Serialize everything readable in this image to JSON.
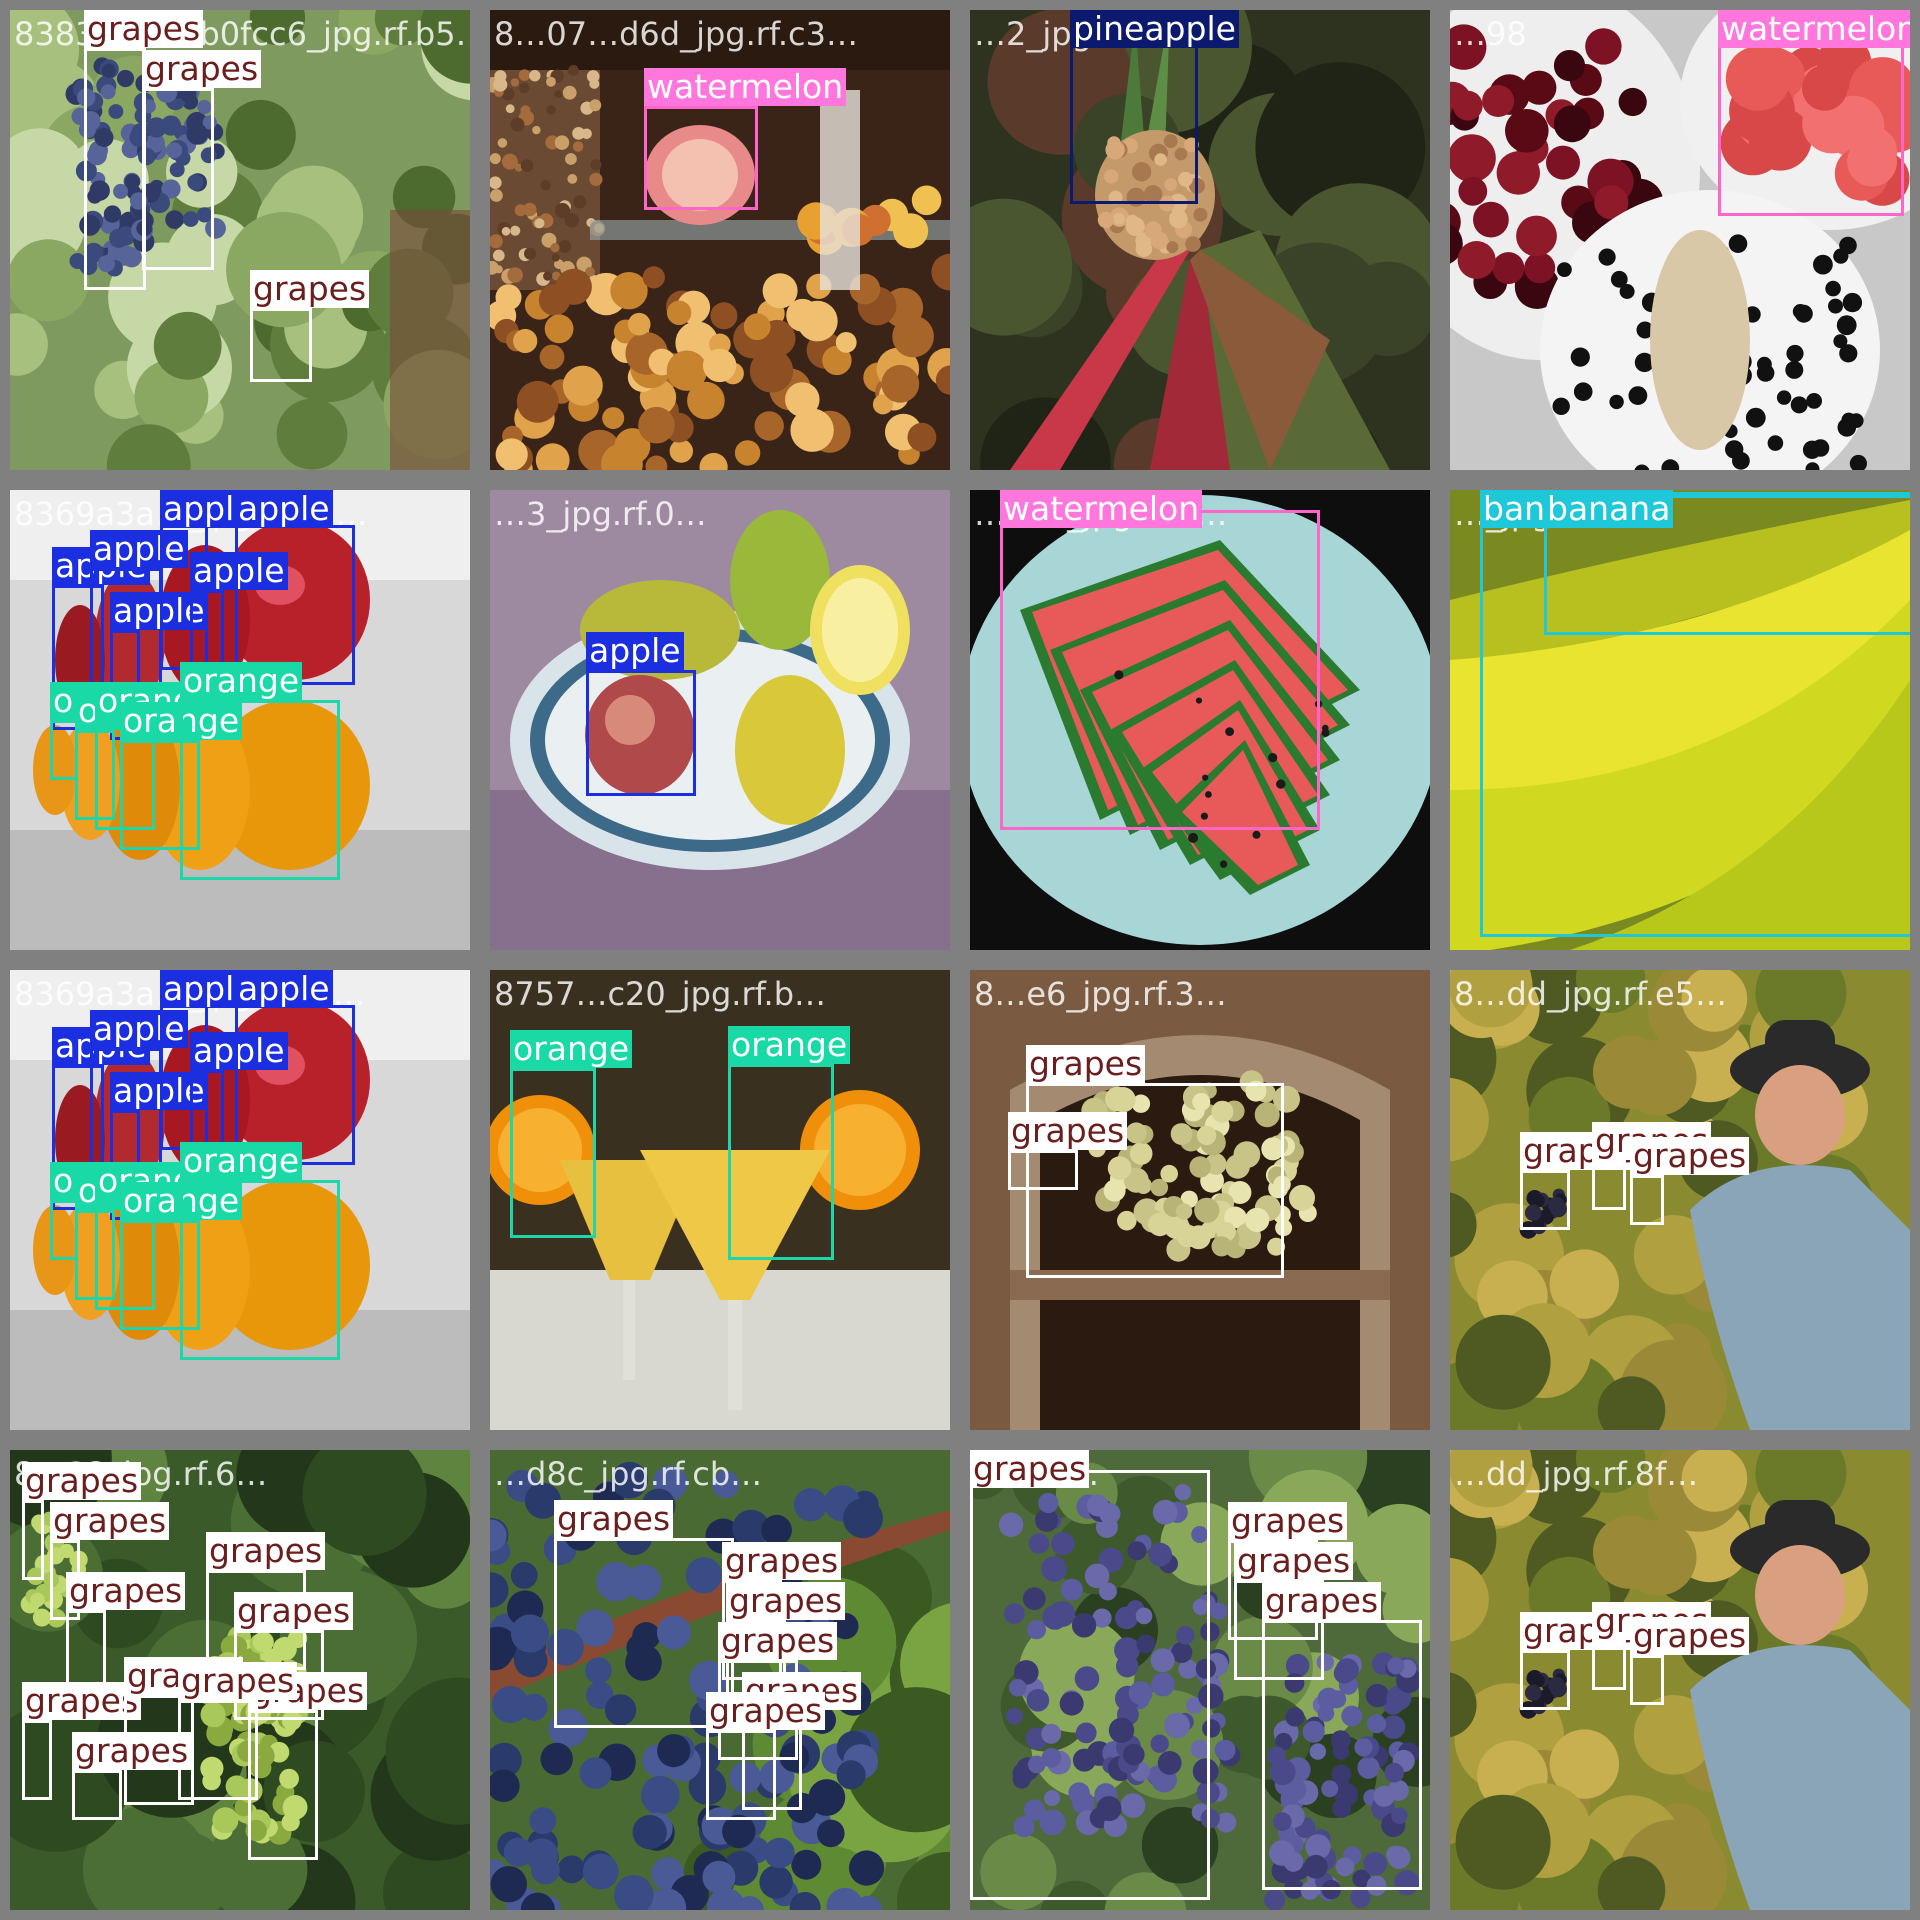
{
  "palette": {
    "grapes": {
      "box": "#ffffff",
      "label_bg": "#ffffff",
      "label_fg": "#6b1e1e"
    },
    "watermelon": {
      "box": "#ff66cc",
      "label_bg": "#ff77dd",
      "label_fg": "#ffffff"
    },
    "pineapple": {
      "box": "#0b1a6e",
      "label_bg": "#0b1a6e",
      "label_fg": "#ffffff"
    },
    "apple": {
      "box": "#1b2ee0",
      "label_bg": "#1b2ee0",
      "label_fg": "#ffffff"
    },
    "orange": {
      "box": "#1ed6a8",
      "label_bg": "#19d9a6",
      "label_fg": "#ffffff"
    },
    "banana": {
      "box": "#1ec8d8",
      "label_bg": "#1ec8d8",
      "label_fg": "#ffffff"
    }
  },
  "tiles": [
    {
      "filename": "8383e…1…b0fcc6_jpg.rf.b5…",
      "scene": "vine-leaves",
      "detections": [
        {
          "cls": "grapes",
          "label": "grapes"
        },
        {
          "cls": "grapes",
          "label": "grapes"
        },
        {
          "cls": "grapes",
          "label": "grapes"
        }
      ]
    },
    {
      "filename": "8…07…d6d_jpg.rf.c3…",
      "scene": "buffet",
      "detections": [
        {
          "cls": "watermelon",
          "label": "watermelon"
        }
      ]
    },
    {
      "filename": "…2_jpg.rf.c6…",
      "scene": "pineapple-plant",
      "detections": [
        {
          "cls": "pineapple",
          "label": "pineapple"
        }
      ]
    },
    {
      "filename": "…98",
      "scene": "cherries-bowls",
      "detections": [
        {
          "cls": "watermelon",
          "label": "watermelon"
        }
      ]
    },
    {
      "filename": "8369a3a…_jpg.rf.db…",
      "scene": "apples-oranges",
      "detections": [
        {
          "cls": "apple",
          "label": "apple"
        },
        {
          "cls": "apple",
          "label": "apple"
        },
        {
          "cls": "apple",
          "label": "apple"
        },
        {
          "cls": "apple",
          "label": "apple"
        },
        {
          "cls": "apple",
          "label": "apple"
        },
        {
          "cls": "apple",
          "label": "apple"
        },
        {
          "cls": "orange",
          "label": "orange"
        },
        {
          "cls": "orange",
          "label": "orange"
        },
        {
          "cls": "orange",
          "label": "orange"
        },
        {
          "cls": "orange",
          "label": "orange"
        },
        {
          "cls": "orange",
          "label": "orange"
        }
      ]
    },
    {
      "filename": "…3_jpg.rf.0…",
      "scene": "lemon-painting",
      "detections": [
        {
          "cls": "apple",
          "label": "apple"
        }
      ]
    },
    {
      "filename": "…526_jpg.rf.4…",
      "scene": "watermelon-plate",
      "detections": [
        {
          "cls": "watermelon",
          "label": "watermelon"
        }
      ]
    },
    {
      "filename": "…_jpg.rf.552",
      "scene": "bananas",
      "detections": [
        {
          "cls": "banana",
          "label": "banana"
        },
        {
          "cls": "banana",
          "label": "banana"
        }
      ]
    },
    {
      "filename": "8369a3a…_jpg.rf.5c…",
      "scene": "apples-oranges",
      "detections": [
        {
          "cls": "apple",
          "label": "apple"
        },
        {
          "cls": "apple",
          "label": "apple"
        },
        {
          "cls": "apple",
          "label": "apple"
        },
        {
          "cls": "apple",
          "label": "apple"
        },
        {
          "cls": "apple",
          "label": "apple"
        },
        {
          "cls": "apple",
          "label": "apple"
        },
        {
          "cls": "orange",
          "label": "orange"
        },
        {
          "cls": "orange",
          "label": "orange"
        },
        {
          "cls": "orange",
          "label": "orange"
        },
        {
          "cls": "orange",
          "label": "orange"
        },
        {
          "cls": "orange",
          "label": "orange"
        }
      ]
    },
    {
      "filename": "8757…c20_jpg.rf.b…",
      "scene": "orange-cocktails",
      "detections": [
        {
          "cls": "orange",
          "label": "orange"
        },
        {
          "cls": "orange",
          "label": "orange"
        }
      ]
    },
    {
      "filename": "8…e6_jpg.rf.3…",
      "scene": "grapes-painting",
      "detections": [
        {
          "cls": "grapes",
          "label": "grapes"
        },
        {
          "cls": "grapes",
          "label": "grapes"
        }
      ]
    },
    {
      "filename": "8…dd_jpg.rf.e5…",
      "scene": "harvester",
      "detections": [
        {
          "cls": "grapes",
          "label": "grapes"
        },
        {
          "cls": "grapes",
          "label": "grapes"
        },
        {
          "cls": "grapes",
          "label": "grapes"
        }
      ]
    },
    {
      "filename": "8…32_jpg.rf.6…",
      "scene": "green-grapes",
      "detections": [
        {
          "cls": "grapes",
          "label": "grapes"
        },
        {
          "cls": "grapes",
          "label": "grapes"
        },
        {
          "cls": "grapes",
          "label": "grapes"
        },
        {
          "cls": "grapes",
          "label": "grapes"
        },
        {
          "cls": "grapes",
          "label": "grapes"
        },
        {
          "cls": "grapes",
          "label": "grapes"
        },
        {
          "cls": "grapes",
          "label": "grapes"
        },
        {
          "cls": "grapes",
          "label": "grapes"
        },
        {
          "cls": "grapes",
          "label": "grapes"
        },
        {
          "cls": "grapes",
          "label": "grapes"
        }
      ]
    },
    {
      "filename": "…d8c_jpg.rf.cb…",
      "scene": "blue-grapes",
      "detections": [
        {
          "cls": "grapes",
          "label": "grapes"
        },
        {
          "cls": "grapes",
          "label": "grapes"
        },
        {
          "cls": "grapes",
          "label": "grapes"
        },
        {
          "cls": "grapes",
          "label": "grapes"
        },
        {
          "cls": "grapes",
          "label": "grapes"
        },
        {
          "cls": "grapes",
          "label": "grapes"
        }
      ]
    },
    {
      "filename": "…759…",
      "scene": "purple-grapes",
      "detections": [
        {
          "cls": "grapes",
          "label": "grapes"
        },
        {
          "cls": "grapes",
          "label": "grapes"
        },
        {
          "cls": "grapes",
          "label": "grapes"
        },
        {
          "cls": "grapes",
          "label": "grapes"
        }
      ]
    },
    {
      "filename": "…dd_jpg.rf.8f…",
      "scene": "harvester",
      "detections": [
        {
          "cls": "grapes",
          "label": "grapes"
        },
        {
          "cls": "grapes",
          "label": "grapes"
        },
        {
          "cls": "grapes",
          "label": "grapes"
        }
      ]
    }
  ]
}
